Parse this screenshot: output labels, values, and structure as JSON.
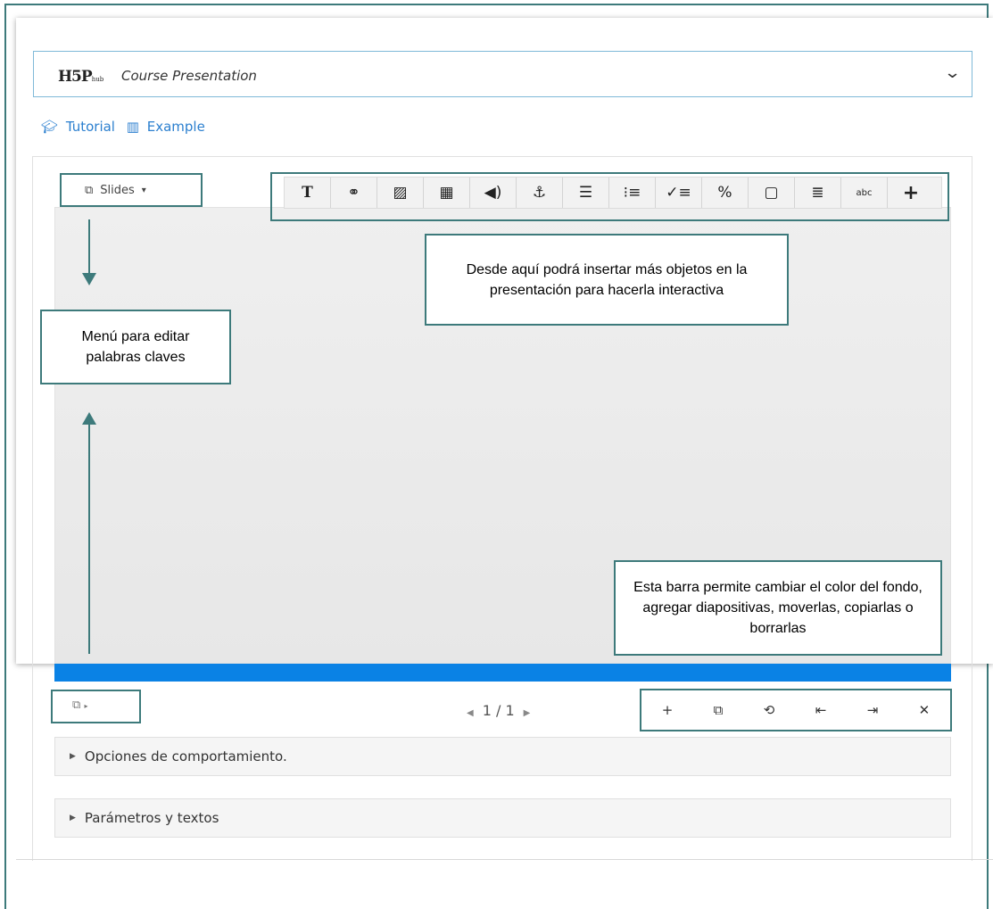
{
  "hub": {
    "logo": "H5P",
    "logo_sub": "hub",
    "content_type": "Course Presentation"
  },
  "links": {
    "tutorial": "Tutorial",
    "example": "Example"
  },
  "editor": {
    "slides_menu_label": "Slides",
    "toolbar_tools": [
      {
        "name": "text",
        "glyph": "T"
      },
      {
        "name": "link",
        "glyph": "⚭"
      },
      {
        "name": "image",
        "glyph": "▨"
      },
      {
        "name": "video",
        "glyph": "▦"
      },
      {
        "name": "audio",
        "glyph": "◀)"
      },
      {
        "name": "anchor",
        "glyph": "⚓"
      },
      {
        "name": "sliders",
        "glyph": "☰"
      },
      {
        "name": "ordered-list",
        "glyph": "⁝≡"
      },
      {
        "name": "checklist",
        "glyph": "✓≡"
      },
      {
        "name": "percent",
        "glyph": "%"
      },
      {
        "name": "dialog",
        "glyph": "▢"
      },
      {
        "name": "list",
        "glyph": "≣"
      },
      {
        "name": "fill-blanks",
        "glyph": "abc"
      },
      {
        "name": "more",
        "glyph": "+"
      }
    ],
    "pager": {
      "text": "1 / 1"
    },
    "slide_tools": [
      "+",
      "⧉",
      "⟲",
      "⇤",
      "⇥",
      "✕"
    ],
    "accordions": [
      "Opciones de comportamiento.",
      "Parámetros y textos"
    ]
  },
  "annotations": {
    "toolbar_note": "Desde aquí podrá insertar más objetos en la presentación para hacerla interactiva",
    "keywords_note": "Menú para editar palabras claves",
    "slidebar_note": "Esta barra permite cambiar el color del fondo, agregar diapositivas, moverlas, copiarlas o borrarlas"
  }
}
